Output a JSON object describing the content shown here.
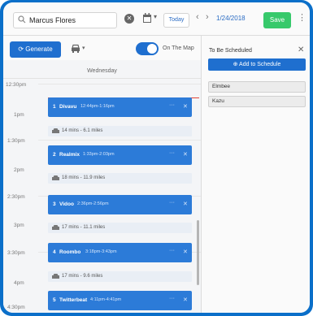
{
  "header": {
    "search_value": "Marcus Flores",
    "today_label": "Today",
    "date": "1/24/2018",
    "save_label": "Save"
  },
  "toolbar": {
    "generate_label": "Generate",
    "map_toggle_label": "On The Map",
    "map_toggle_on": true,
    "day_label": "Wednesday"
  },
  "side_panel": {
    "title": "To Be Scheduled",
    "add_label": "Add to Schedule",
    "items": [
      "Elmbee",
      "Kazu"
    ]
  },
  "schedule": {
    "times": [
      "12:30pm",
      "1pm",
      "1:30pm",
      "2pm",
      "2:30pm",
      "3pm",
      "3:30pm",
      "4pm",
      "4:30pm"
    ],
    "appointments": [
      {
        "num": "1",
        "name": "Divavu",
        "time": "12:44pm-1:16pm"
      },
      {
        "num": "2",
        "name": "Realmix",
        "time": "1:33pm-2:03pm"
      },
      {
        "num": "3",
        "name": "Vidoo",
        "time": "2:36pm-2:56pm"
      },
      {
        "num": "4",
        "name": "Roombo",
        "time": "3:18pm-3:43pm"
      },
      {
        "num": "5",
        "name": "Twitterbeat",
        "time": "4:11pm-4:41pm"
      }
    ],
    "travel": [
      "14 mins - 6.1 miles",
      "18 mins - 11.9 miles",
      "17 mins - 11.1 miles",
      "17 mins - 9.6 miles"
    ]
  },
  "colors": {
    "accent": "#1f6fcf",
    "save": "#37c96b",
    "appointment": "#2c7bd8",
    "now_line": "#e0463b",
    "frame": "#0b6fc9"
  }
}
